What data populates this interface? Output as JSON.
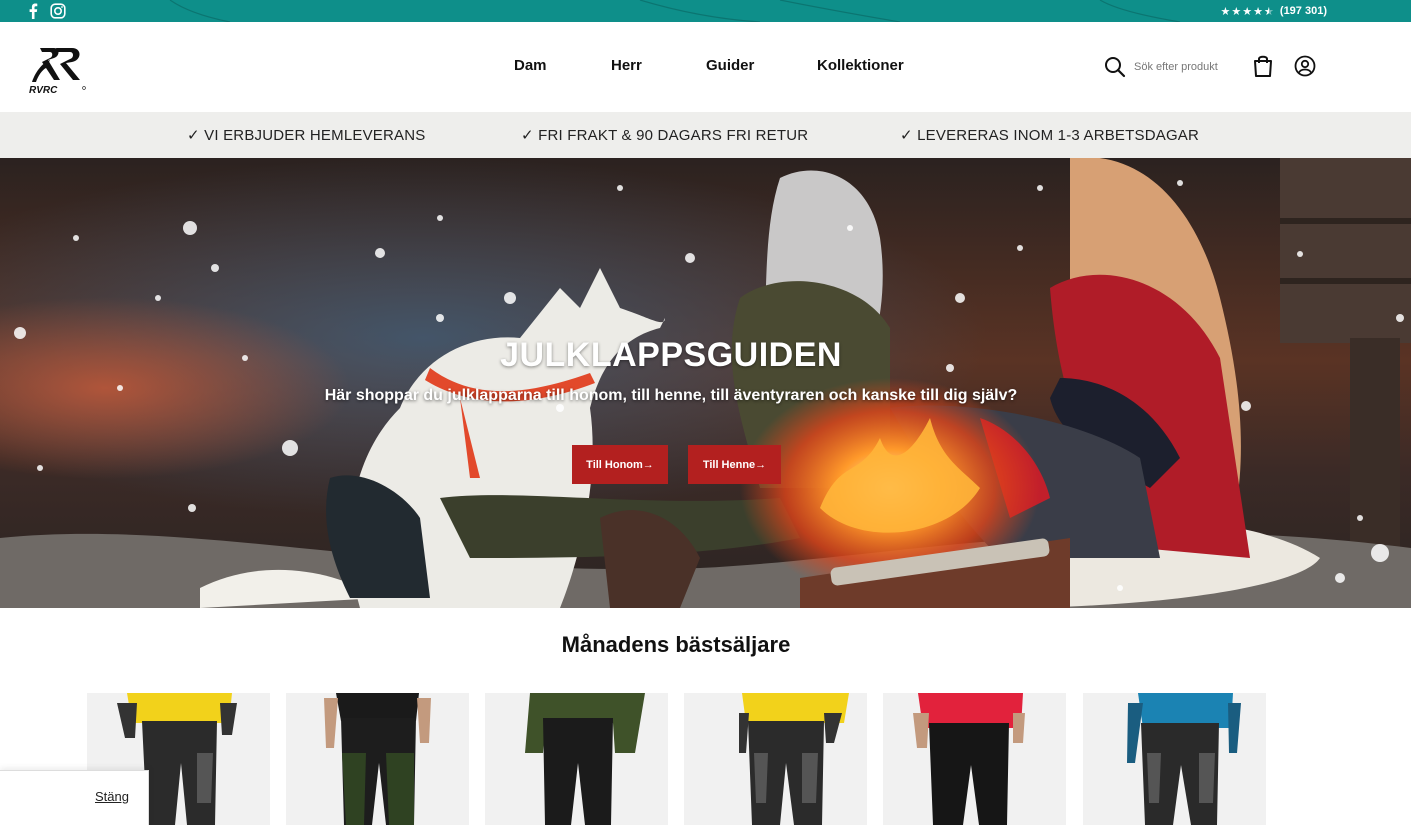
{
  "topbar": {
    "rating_text": "(197 301)",
    "stars": 4.5,
    "social": [
      "facebook-icon",
      "instagram-icon"
    ],
    "color": "#0e8f8a"
  },
  "header": {
    "logo_text": "RVRC",
    "nav": [
      "Dam",
      "Herr",
      "Guider",
      "Kollektioner"
    ],
    "search_placeholder": "Sök efter produkt"
  },
  "usp": [
    "✓ VI ERBJUDER HEMLEVERANS",
    "✓ FRI FRAKT & 90 DAGARS FRI RETUR",
    "✓ LEVERERAS INOM 1-3 ARBETSDAGAR"
  ],
  "hero": {
    "title": "JULKLAPPSGUIDEN",
    "subtitle": "Här shoppar du julklapparna till honom, till henne, till äventyraren och kanske till dig själv?",
    "button_him": "Till Honom→",
    "button_her": "Till Henne→",
    "button_color": "#b3201f"
  },
  "bestsellers": {
    "title": "Månadens bästsäljare",
    "products": [
      {
        "top_color": "#f2d21b",
        "pants_color": "#2b2b2b"
      },
      {
        "top_color": "#1a1a1a",
        "pants_color": "#2f4222"
      },
      {
        "top_color": "#3f5229",
        "pants_color": "#1b1b1b"
      },
      {
        "top_color": "#f2d21b",
        "pants_color": "#2b2b2b"
      },
      {
        "top_color": "#e2223c",
        "pants_color": "#161616"
      },
      {
        "top_color": "#1b83b3",
        "pants_color": "#2a2a2a"
      }
    ]
  },
  "close_panel": {
    "close_label": "Stäng"
  }
}
